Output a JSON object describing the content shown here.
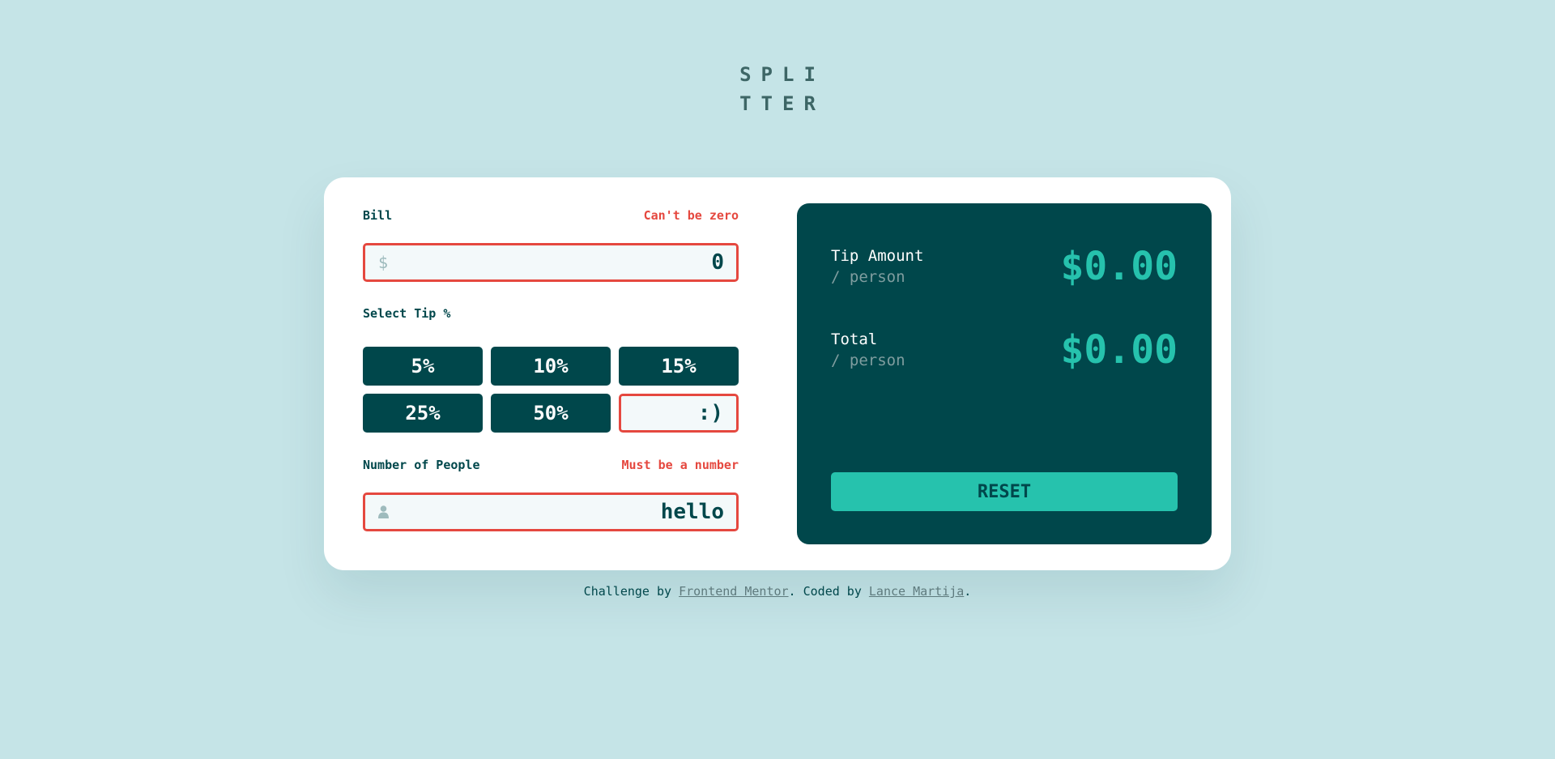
{
  "logo": {
    "line1": "SPLI",
    "line2": "TTER"
  },
  "bill": {
    "label": "Bill",
    "error": "Can't be zero",
    "prefix": "$",
    "value": "0"
  },
  "tip": {
    "label": "Select Tip %",
    "options": [
      "5%",
      "10%",
      "15%",
      "25%",
      "50%"
    ],
    "custom_value": ":)"
  },
  "people": {
    "label": "Number of People",
    "error": "Must be a number",
    "icon": "person-icon",
    "value": "hello"
  },
  "results": {
    "tip_amount": {
      "label": "Tip Amount",
      "sub": "/ person",
      "value": "$0.00"
    },
    "total": {
      "label": "Total",
      "sub": "/ person",
      "value": "$0.00"
    },
    "reset_label": "RESET"
  },
  "footer": {
    "prefix": "Challenge by ",
    "link1": "Frontend Mentor",
    "middle": ". Coded by ",
    "link2": "Lance Martija",
    "suffix": "."
  },
  "colors": {
    "background": "#c5e4e7",
    "dark_cyan": "#00474b",
    "accent": "#26c2ad",
    "error": "#e5483f"
  }
}
